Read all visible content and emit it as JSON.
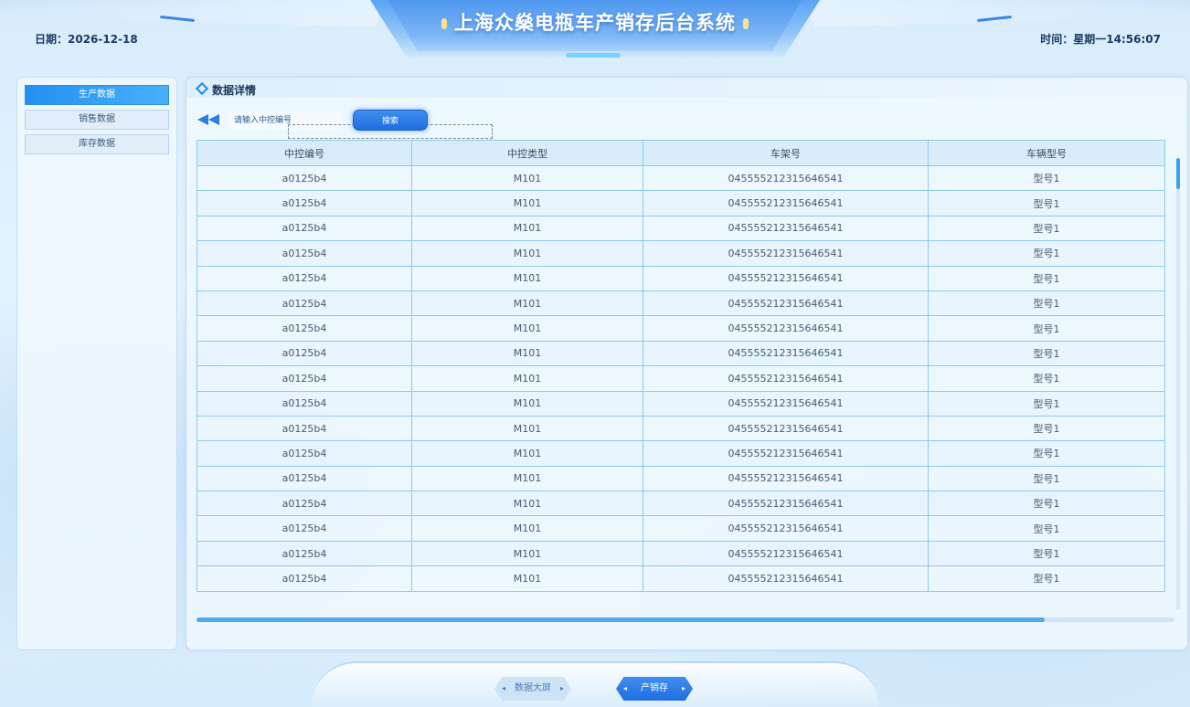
{
  "header": {
    "title": "上海众燊电瓶车产销存后台系统",
    "date": "日期：2026-12-18",
    "time": "时间：星期一14:56:07"
  },
  "sidebar": {
    "items": [
      {
        "label": "生产数据",
        "active": true
      },
      {
        "label": "销售数据",
        "active": false
      },
      {
        "label": "库存数据",
        "active": false
      }
    ]
  },
  "panel": {
    "title": "数据详情",
    "search": {
      "placeholder": "请输入中控编号",
      "button_label": "搜索"
    }
  },
  "table": {
    "columns": [
      "中控编号",
      "中控类型",
      "车架号",
      "车辆型号"
    ],
    "rows": [
      [
        "a0125b4",
        "M101",
        "045555212315646541",
        "型号1"
      ],
      [
        "a0125b4",
        "M101",
        "045555212315646541",
        "型号1"
      ],
      [
        "a0125b4",
        "M101",
        "045555212315646541",
        "型号1"
      ],
      [
        "a0125b4",
        "M101",
        "045555212315646541",
        "型号1"
      ],
      [
        "a0125b4",
        "M101",
        "045555212315646541",
        "型号1"
      ],
      [
        "a0125b4",
        "M101",
        "045555212315646541",
        "型号1"
      ],
      [
        "a0125b4",
        "M101",
        "045555212315646541",
        "型号1"
      ],
      [
        "a0125b4",
        "M101",
        "045555212315646541",
        "型号1"
      ],
      [
        "a0125b4",
        "M101",
        "045555212315646541",
        "型号1"
      ],
      [
        "a0125b4",
        "M101",
        "045555212315646541",
        "型号1"
      ],
      [
        "a0125b4",
        "M101",
        "045555212315646541",
        "型号1"
      ],
      [
        "a0125b4",
        "M101",
        "045555212315646541",
        "型号1"
      ],
      [
        "a0125b4",
        "M101",
        "045555212315646541",
        "型号1"
      ],
      [
        "a0125b4",
        "M101",
        "045555212315646541",
        "型号1"
      ],
      [
        "a0125b4",
        "M101",
        "045555212315646541",
        "型号1"
      ],
      [
        "a0125b4",
        "M101",
        "045555212315646541",
        "型号1"
      ],
      [
        "a0125b4",
        "M101",
        "045555212315646541",
        "型号1"
      ]
    ]
  },
  "footer": {
    "nav": [
      {
        "label": "数据大屏",
        "active": false
      },
      {
        "label": "产销存",
        "active": true
      }
    ]
  },
  "colors": {
    "accent": "#2390f1",
    "title_bg": "#4f97ef",
    "table_border": "#8fcaeb"
  }
}
